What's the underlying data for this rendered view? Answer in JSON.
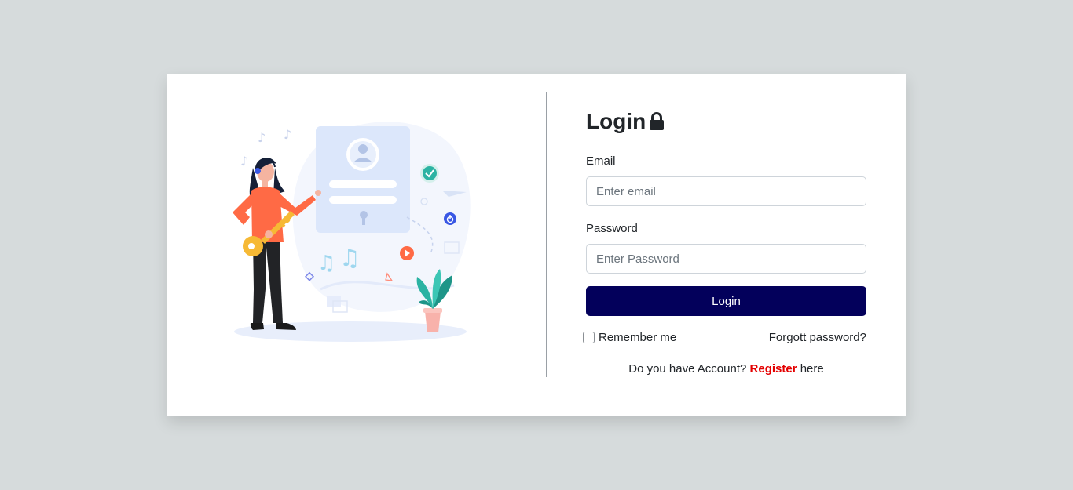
{
  "login": {
    "title": "Login",
    "email_label": "Email",
    "email_placeholder": "Enter email",
    "email_value": "",
    "password_label": "Password",
    "password_placeholder": "Enter Password",
    "password_value": "",
    "button_label": "Login",
    "remember_label": "Remember me",
    "remember_checked": false,
    "forgot_label": "Forgott password?",
    "register_prefix": "Do you have Account?",
    "register_link": "Register",
    "register_suffix": "here"
  },
  "colors": {
    "page_background": "#d6dbdc",
    "button": "#03005b",
    "register_link": "#e40000"
  },
  "icons": {
    "title_icon": "lock-icon"
  }
}
